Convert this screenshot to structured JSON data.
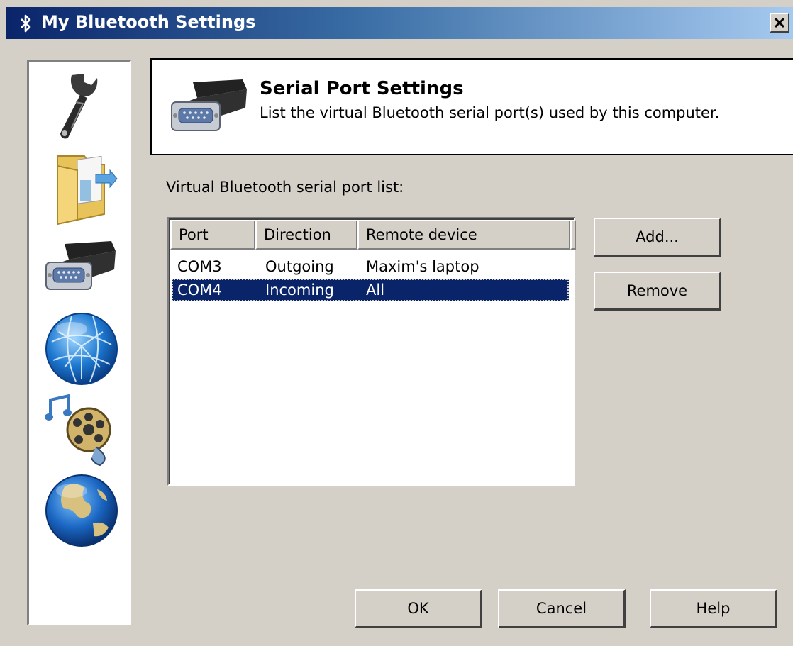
{
  "window": {
    "title": "My Bluetooth Settings",
    "close_label": "X"
  },
  "sidebar": {
    "items": [
      {
        "name": "wrench-icon"
      },
      {
        "name": "folder-icon"
      },
      {
        "name": "serial-port-icon"
      },
      {
        "name": "network-globe-icon"
      },
      {
        "name": "multimedia-icon"
      },
      {
        "name": "earth-globe-icon"
      }
    ]
  },
  "header": {
    "icon": "serial-port-icon",
    "title": "Serial Port Settings",
    "description": "List the virtual Bluetooth serial port(s) used by this computer."
  },
  "list": {
    "label": "Virtual Bluetooth serial port list:",
    "columns": [
      "Port",
      "Direction",
      "Remote device"
    ],
    "rows": [
      {
        "port": "COM3",
        "direction": "Outgoing",
        "remote": "Maxim's laptop",
        "selected": false
      },
      {
        "port": "COM4",
        "direction": "Incoming",
        "remote": "All",
        "selected": true
      }
    ]
  },
  "buttons": {
    "add": "Add...",
    "remove": "Remove",
    "ok": "OK",
    "cancel": "Cancel",
    "help": "Help"
  },
  "colors": {
    "titlebar_start": "#0a246a",
    "titlebar_end": "#a6caf0",
    "selection": "#0a246a",
    "face": "#d4d0c8"
  }
}
